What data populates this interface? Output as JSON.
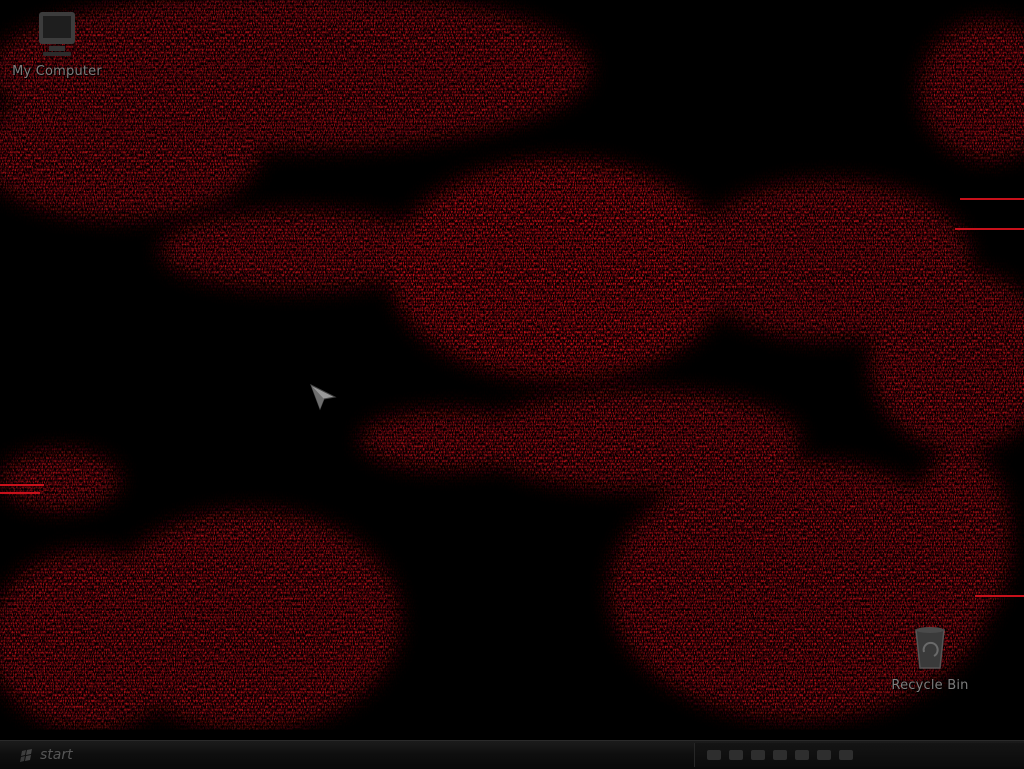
{
  "desktop": {
    "icons": [
      {
        "label": "My Computer",
        "icon": "computer-icon"
      },
      {
        "label": "Recycle Bin",
        "icon": "recycle-bin-icon"
      }
    ],
    "cursor": "arrow-cursor-icon",
    "wallpaper": {
      "theme": "red-glitch-texture",
      "accent": "#c8101a",
      "background": "#000000"
    }
  },
  "taskbar": {
    "start_label": "start",
    "start_icon": "windows-logo-icon",
    "tray_icons": [
      "tray-app-icon-1",
      "tray-app-icon-2",
      "tray-app-icon-3",
      "tray-app-icon-4",
      "tray-app-icon-5",
      "tray-app-icon-6",
      "tray-app-icon-7"
    ]
  }
}
